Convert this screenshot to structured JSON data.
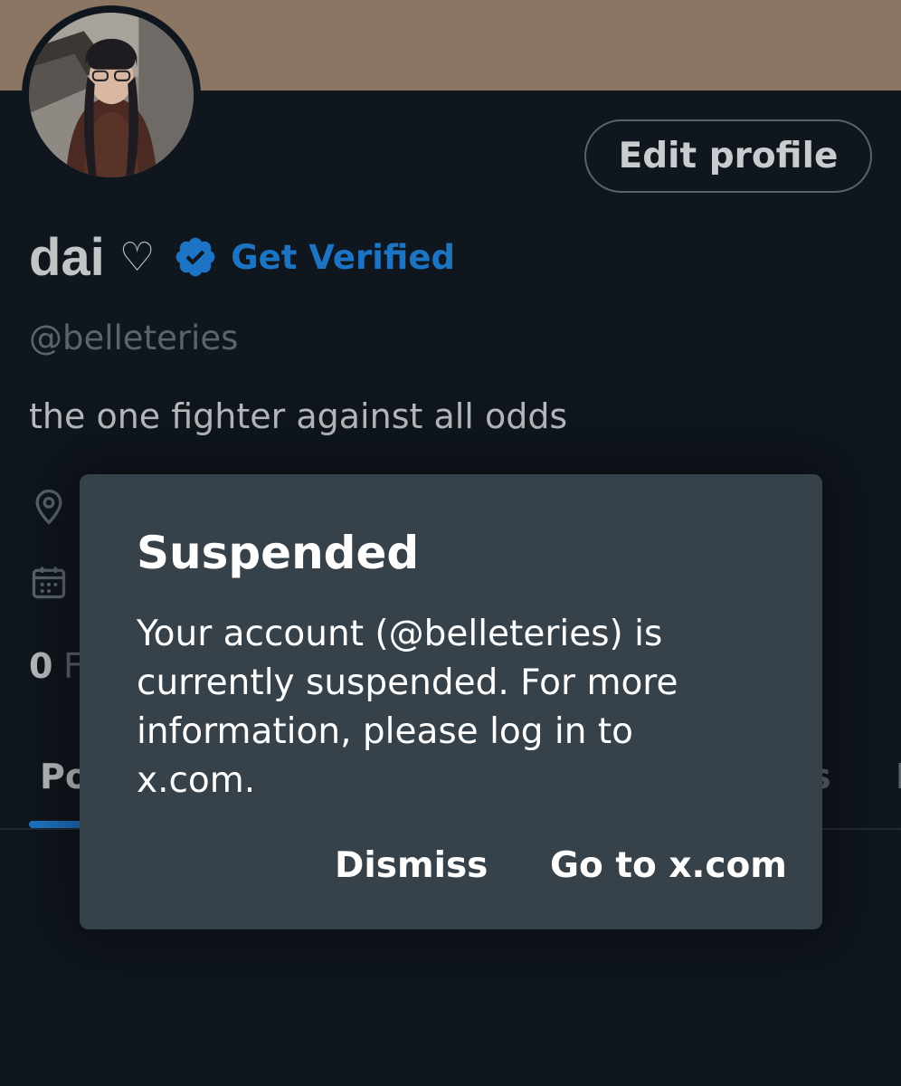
{
  "profile": {
    "display_name": "dai",
    "name_emoji": "♡",
    "verified_badge_icon": "verified-badge-icon",
    "get_verified_label": "Get Verified",
    "handle": "@belleteries",
    "bio": "the one fighter against all odds",
    "edit_profile_label": "Edit profile",
    "following_count": "0",
    "following_label_fragment": "F"
  },
  "tabs": {
    "posts_fragment": "Po",
    "right_fragment": "s",
    "edge_fragment": "I"
  },
  "icons": {
    "location": "location-pin-icon",
    "joined": "calendar-icon"
  },
  "dialog": {
    "title": "Suspended",
    "message": "Your account (@belleteries) is currently suspended. For more information, please log in to x.com.",
    "dismiss_label": "Dismiss",
    "goto_label": "Go to x.com"
  },
  "colors": {
    "background": "#0f161d",
    "banner": "#8b7563",
    "accent": "#1d74c4",
    "dialog": "#37414a",
    "muted_text": "#5c646b"
  }
}
